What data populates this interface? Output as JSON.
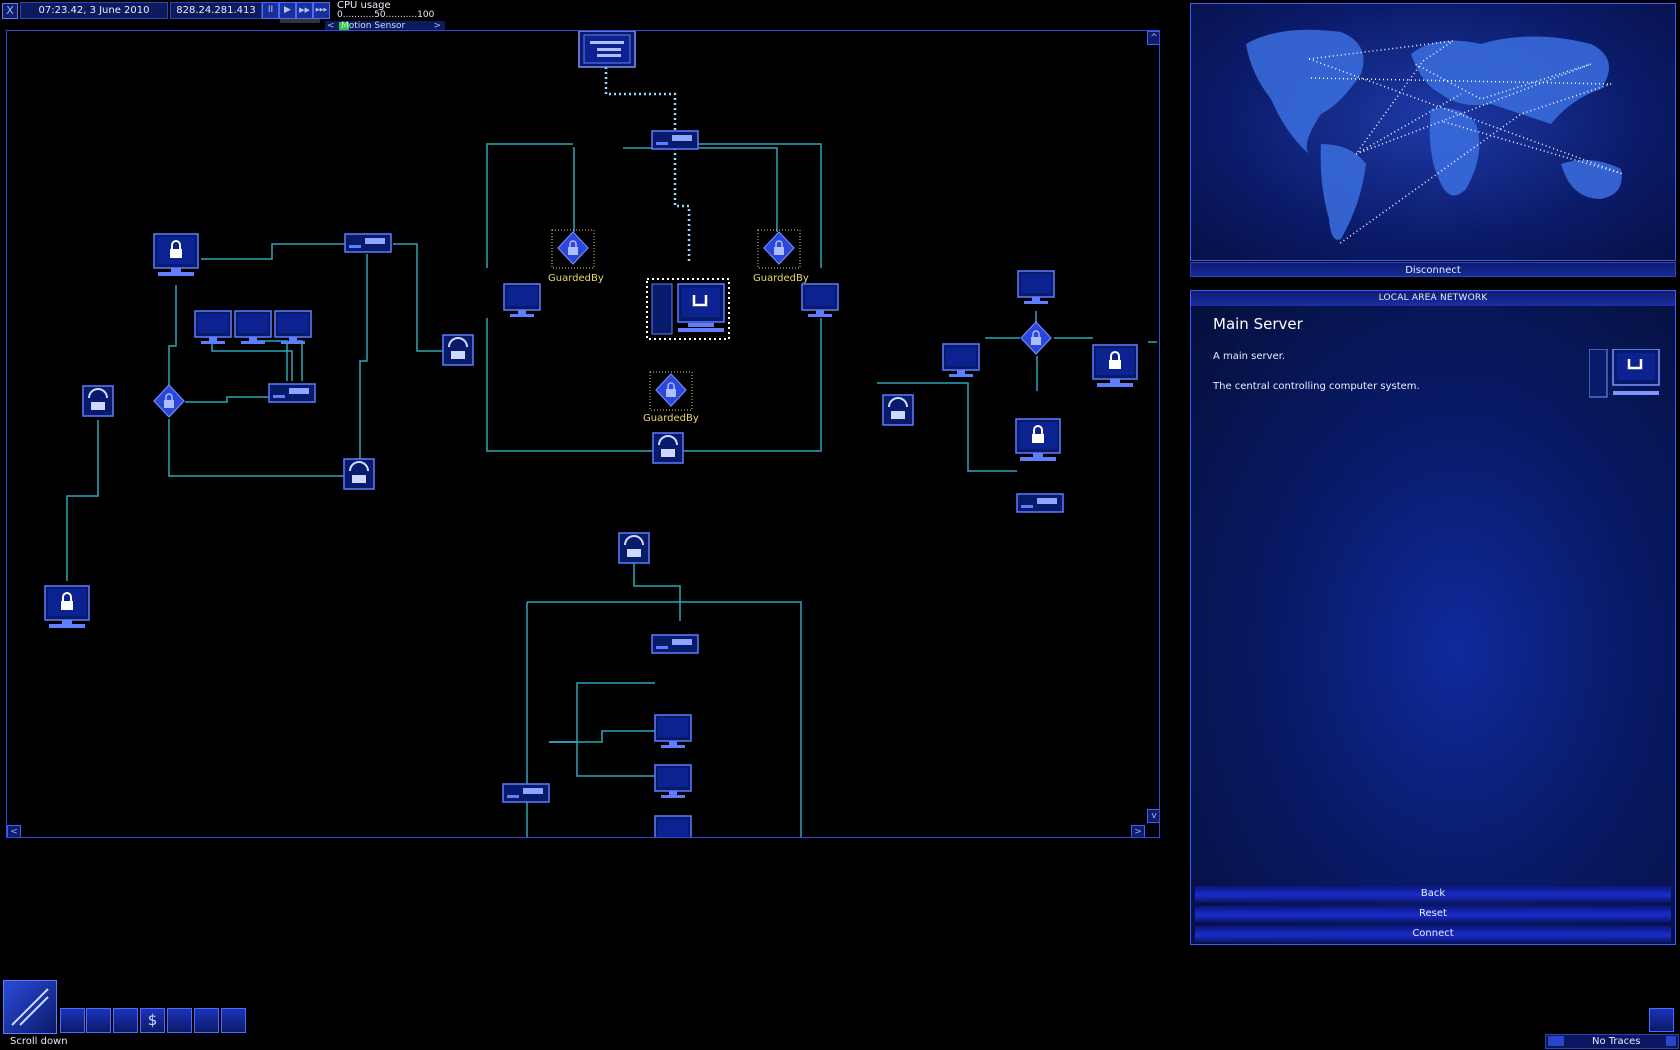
{
  "topbar": {
    "close": "X",
    "clock": "07:23.42, 3 June 2010",
    "ip": "828.24.281.413",
    "speed_buttons": [
      "II",
      "▶",
      "▶▶",
      "▶▶▶"
    ],
    "cpu_label": "CPU usage",
    "cpu_scale": "0...........50...........100",
    "sensor_label": "Motion  Sensor",
    "sensor_left": "<",
    "sensor_right": ">"
  },
  "network": {
    "labels": {
      "guard1": "GuardedBy",
      "guard2": "GuardedBy",
      "guard3": "GuardedBy"
    },
    "scroll": {
      "up": "^",
      "down": "v",
      "left": "<",
      "right": ">"
    },
    "colors": {
      "link": "#2fa6b8",
      "active_link": "#8fdcff",
      "node": "#2b46d8"
    }
  },
  "map": {
    "disconnect_label": "Disconnect"
  },
  "info": {
    "header": "LOCAL AREA NETWORK",
    "title": "Main Server",
    "desc1": "A main server.",
    "desc2": "The central controlling computer system.",
    "back": "Back",
    "reset": "Reset",
    "connect": "Connect",
    "icon": "server-icon"
  },
  "toolbar": {
    "icons": [
      "globe-icon",
      "memory-icon",
      "disk-icon",
      "person-icon",
      "finance-icon",
      "email-icon",
      "network-icon",
      "hardware-icon"
    ],
    "status": "Scroll down"
  },
  "traces": {
    "label": "No Traces"
  }
}
